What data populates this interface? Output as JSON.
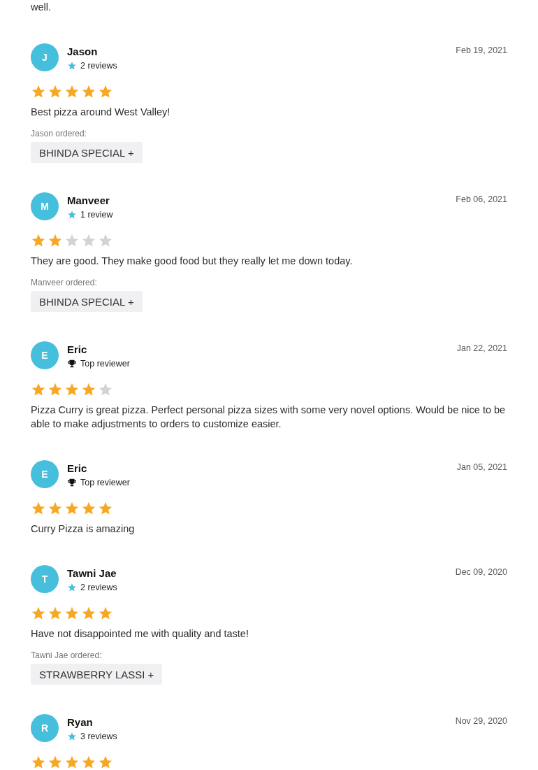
{
  "previous_text": "well.",
  "reviews": [
    {
      "initial": "J",
      "name": "Jason",
      "badge": {
        "kind": "reviews",
        "label": "2 reviews"
      },
      "date": "Feb 19, 2021",
      "stars": 5,
      "text": "Best pizza around West Valley!",
      "ordered_label": "Jason ordered:",
      "ordered_items": [
        "BHINDA SPECIAL +"
      ]
    },
    {
      "initial": "M",
      "name": "Manveer",
      "badge": {
        "kind": "reviews",
        "label": "1 review"
      },
      "date": "Feb 06, 2021",
      "stars": 2,
      "text": "They are good. They make good food but they really let me down today.",
      "ordered_label": "Manveer ordered:",
      "ordered_items": [
        "BHINDA SPECIAL +"
      ]
    },
    {
      "initial": "E",
      "name": "Eric",
      "badge": {
        "kind": "top",
        "label": "Top reviewer"
      },
      "date": "Jan 22, 2021",
      "stars": 4,
      "text": "Pizza Curry is great pizza. Perfect personal pizza sizes with some very novel options. Would be nice to be able to make adjustments to orders to customize easier."
    },
    {
      "initial": "E",
      "name": "Eric",
      "badge": {
        "kind": "top",
        "label": "Top reviewer"
      },
      "date": "Jan 05, 2021",
      "stars": 5,
      "text": "Curry Pizza is amazing"
    },
    {
      "initial": "T",
      "name": "Tawni Jae",
      "badge": {
        "kind": "reviews",
        "label": "2 reviews"
      },
      "date": "Dec 09, 2020",
      "stars": 5,
      "text": "Have not disappointed me with quality and taste!",
      "ordered_label": "Tawni Jae ordered:",
      "ordered_items": [
        "STRAWBERRY LASSI +"
      ]
    },
    {
      "initial": "R",
      "name": "Ryan",
      "badge": {
        "kind": "reviews",
        "label": "3 reviews"
      },
      "date": "Nov 29, 2020",
      "stars": 5
    }
  ]
}
